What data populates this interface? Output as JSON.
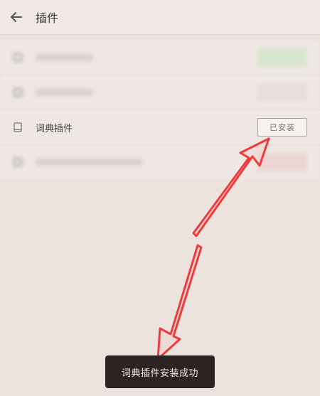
{
  "header": {
    "title": "插件",
    "back_icon": "arrow-left-icon"
  },
  "plugins": [
    {
      "label": "",
      "action": "",
      "action_style": "green",
      "blurred": true,
      "icon": "plugin-icon"
    },
    {
      "label": "",
      "action": "",
      "action_style": "grey",
      "blurred": true,
      "icon": "plugin-icon"
    },
    {
      "label": "词典插件",
      "action": "已安装",
      "action_style": "installed",
      "blurred": false,
      "icon": "book-icon"
    },
    {
      "label": "",
      "action": "",
      "action_style": "red",
      "blurred": true,
      "icon": "plugin-icon"
    }
  ],
  "toast": {
    "text": "词典插件安装成功"
  },
  "annotation": {
    "arrow_color": "#ee3b3b"
  }
}
